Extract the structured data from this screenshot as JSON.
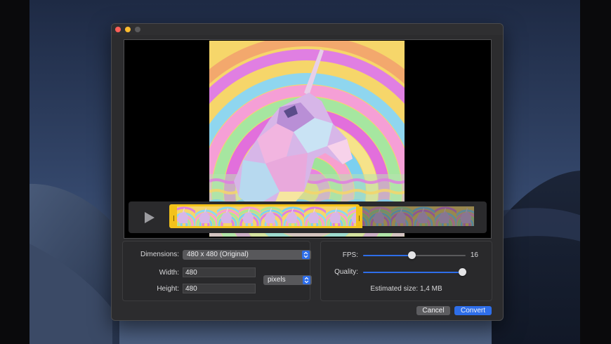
{
  "window": {
    "controls": [
      "close-button",
      "minimize-button",
      "zoom-button"
    ],
    "colors": {
      "close": "#fe5f57",
      "minimize": "#febc2e",
      "accent": "#2e6ee9",
      "trim_handle": "#f3c21a"
    }
  },
  "player": {
    "play_icon": "play-icon",
    "preview_content": "rainbow unicorn animation",
    "timeline_frames": 14,
    "trim_start_fraction": 0.0,
    "trim_end_fraction": 0.62
  },
  "dimensions": {
    "label": "Dimensions:",
    "value": "480 x 480 (Original)",
    "width_label": "Width:",
    "width_value": "480",
    "height_label": "Height:",
    "height_value": "480",
    "unit_value": "pixels"
  },
  "output": {
    "fps_label": "FPS:",
    "fps_value": "16",
    "fps_fraction": 0.47,
    "quality_label": "Quality:",
    "quality_fraction": 1.0,
    "estimated_size": "Estimated size: 1,4 MB"
  },
  "buttons": {
    "cancel": "Cancel",
    "convert": "Convert"
  }
}
